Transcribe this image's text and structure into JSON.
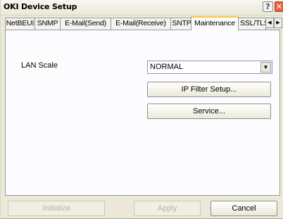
{
  "window": {
    "title": "OKI Device Setup",
    "help_glyph": "?",
    "close_glyph": "✕"
  },
  "tabs": [
    {
      "label": "NetBEUI"
    },
    {
      "label": "SNMP"
    },
    {
      "label": "E-Mail(Send)"
    },
    {
      "label": "E-Mail(Receive)"
    },
    {
      "label": "SNTP"
    },
    {
      "label": "Maintenance",
      "active": true
    },
    {
      "label": "SSL/TLS"
    }
  ],
  "tab_scroll": {
    "left_glyph": "◀",
    "right_glyph": "▶"
  },
  "maintenance": {
    "lan_scale_label": "LAN Scale",
    "lan_scale_value": "NORMAL",
    "combo_arrow": "▼",
    "ip_filter_button": "IP Filter Setup...",
    "service_button": "Service..."
  },
  "footer": {
    "initialize_label": "Initialize",
    "apply_label": "Apply",
    "cancel_label": "Cancel"
  },
  "colors": {
    "window_bg": "#ece9d8",
    "panel_bg": "#fcfcfe",
    "active_tab_accent": "#ffc83c",
    "close_button": "#ea5f3d"
  }
}
